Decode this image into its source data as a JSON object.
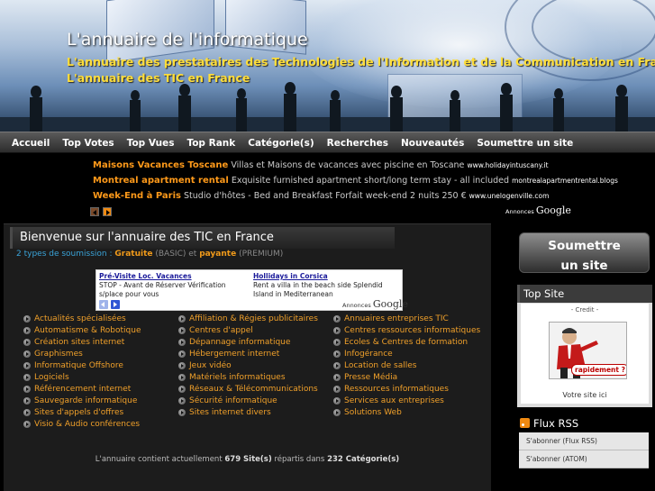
{
  "header": {
    "title": "L'annuaire de l'informatique",
    "tagline1": "L'annuaire des prestataires des Technologies de l'Information et de la Communication en France.",
    "tagline2": "L'annuaire des TIC en France"
  },
  "nav": [
    "Accueil",
    "Top Votes",
    "Top Vues",
    "Top Rank",
    "Catégorie(s)",
    "Recherches",
    "Nouveautés",
    "Soumettre un site"
  ],
  "top_ads": [
    {
      "title": "Maisons Vacances Toscane",
      "text": "Villas et Maisons de vacances avec piscine en Toscane",
      "url": "www.holidayintuscany.it"
    },
    {
      "title": "Montreal apartment rental",
      "text": "Exquisite furnished apartment short/long term stay - all included",
      "url": "montrealapartmentrental.blogs"
    },
    {
      "title": "Week-End à Paris",
      "text": "Studio d'hôtes - Bed and Breakfast Forfait week-end 2 nuits 250 €",
      "url": "www.unelogenville.com"
    }
  ],
  "ads_by": {
    "prefix": "Annonces",
    "brand": "Google"
  },
  "main": {
    "title": "Bienvenue sur l'annuaire des TIC en France",
    "submission": {
      "prefix": "2 types de soumission :",
      "free": "Gratuite",
      "free_note": "(BASIC) et",
      "paid": "payante",
      "paid_note": "(PREMIUM)"
    }
  },
  "google_ads": [
    {
      "title": "Pré-Visite Loc. Vacances",
      "text": "STOP - Avant de Réserver Vérification s/place pour vous"
    },
    {
      "title": "Hollidays in Corsica",
      "text": "Rent a villa in the beach side Splendid Island in Mediterranean"
    }
  ],
  "categories": {
    "col1": [
      "Actualités spécialisées",
      "Automatisme & Robotique",
      "Création sites internet",
      "Graphismes",
      "Informatique Offshore",
      "Logiciels",
      "Référencement internet",
      "Sauvegarde informatique",
      "Sites d'appels d'offres",
      "Visio & Audio conférences"
    ],
    "col2": [
      "Affiliation & Régies publicitaires",
      "Centres d'appel",
      "Dépannage informatique",
      "Hébergement internet",
      "Jeux vidéo",
      "Matériels informatiques",
      "Réseaux & Télécommunications",
      "Sécurité informatique",
      "Sites internet divers"
    ],
    "col3": [
      "Annuaires entreprises TIC",
      "Centres ressources informatiques",
      "Ecoles & Centres de formation",
      "Infogérance",
      "Location de salles",
      "Presse Média",
      "Ressources informatiques",
      "Services aux entreprises",
      "Solutions Web"
    ]
  },
  "stats": {
    "prefix": "L'annuaire contient actuellement",
    "sites": "679 Site(s)",
    "middle": "répartis dans",
    "cats": "232 Catégorie(s)"
  },
  "sidebar": {
    "submit_line1": "Soumettre",
    "submit_line2": "un site",
    "top_site_title": "Top Site",
    "credit": "- Credit -",
    "ad_text": "rapidement ?",
    "votre_site": "Votre site ici",
    "rss_title": "Flux RSS",
    "rss_links": [
      "S'abonner (Flux RSS)",
      "S'abonner (ATOM)"
    ]
  }
}
